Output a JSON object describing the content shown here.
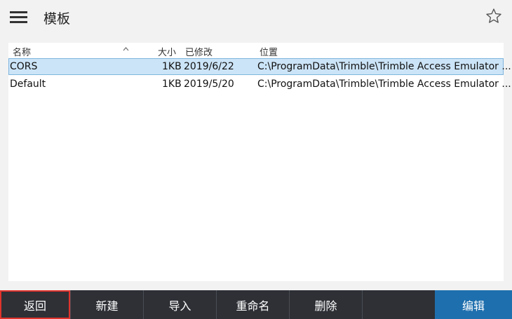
{
  "header": {
    "title": "模板",
    "menu_icon": "hamburger-menu-icon",
    "favorite_icon": "star-outline-icon"
  },
  "table": {
    "columns": {
      "name": "名称",
      "size": "大小",
      "modified": "已修改",
      "location": "位置"
    },
    "rows": [
      {
        "name": "CORS",
        "size": "1KB",
        "modified": "2019/6/22",
        "location": "C:\\ProgramData\\Trimble\\Trimble Access Emulator ...",
        "selected": true
      },
      {
        "name": "Default",
        "size": "1KB",
        "modified": "2019/5/20",
        "location": "C:\\ProgramData\\Trimble\\Trimble Access Emulator ...",
        "selected": false
      }
    ]
  },
  "toolbar": {
    "back": "返回",
    "new": "新建",
    "import": "导入",
    "rename": "重命名",
    "delete": "删除",
    "edit": "编辑"
  },
  "colors": {
    "selected_row": "#cce4f7",
    "toolbar_bg": "#2e3036",
    "edit_button": "#1e6fae",
    "highlight_outline": "#e0332c"
  }
}
